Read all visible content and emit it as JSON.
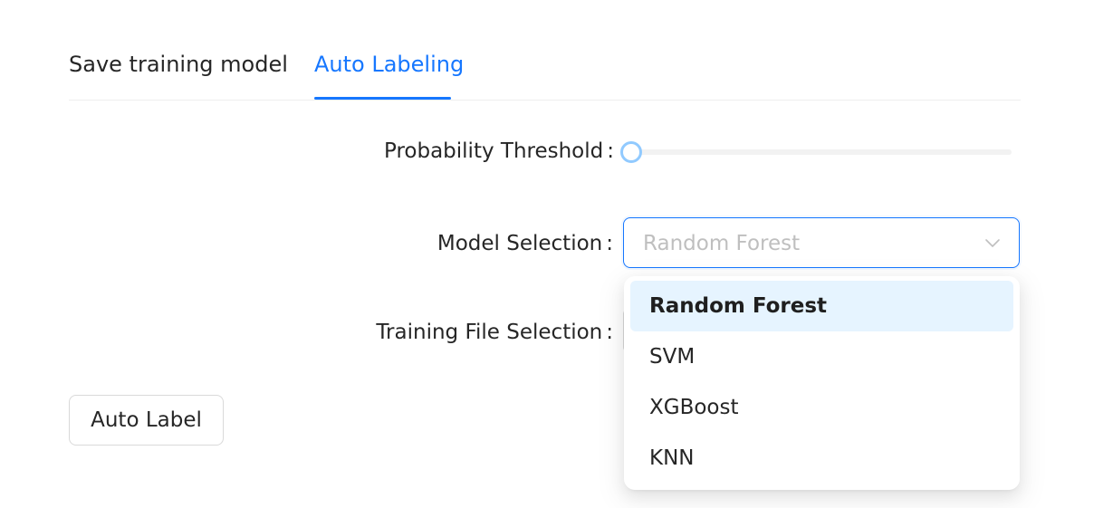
{
  "tabs": {
    "items": [
      {
        "label": "Save training model",
        "active": false
      },
      {
        "label": "Auto Labeling",
        "active": true
      }
    ],
    "active_color": "#1677ff"
  },
  "form": {
    "threshold": {
      "label": "Probability Threshold",
      "colon": ":",
      "value": 0
    },
    "model": {
      "label": "Model Selection",
      "colon": ":",
      "placeholder": "Random Forest"
    },
    "file": {
      "label": "Training File Selection",
      "colon": ":"
    }
  },
  "dropdown": {
    "options": [
      "Random Forest",
      "SVM",
      "XGBoost",
      "KNN"
    ],
    "selected": "Random Forest"
  },
  "actions": {
    "auto_label": "Auto Label"
  }
}
